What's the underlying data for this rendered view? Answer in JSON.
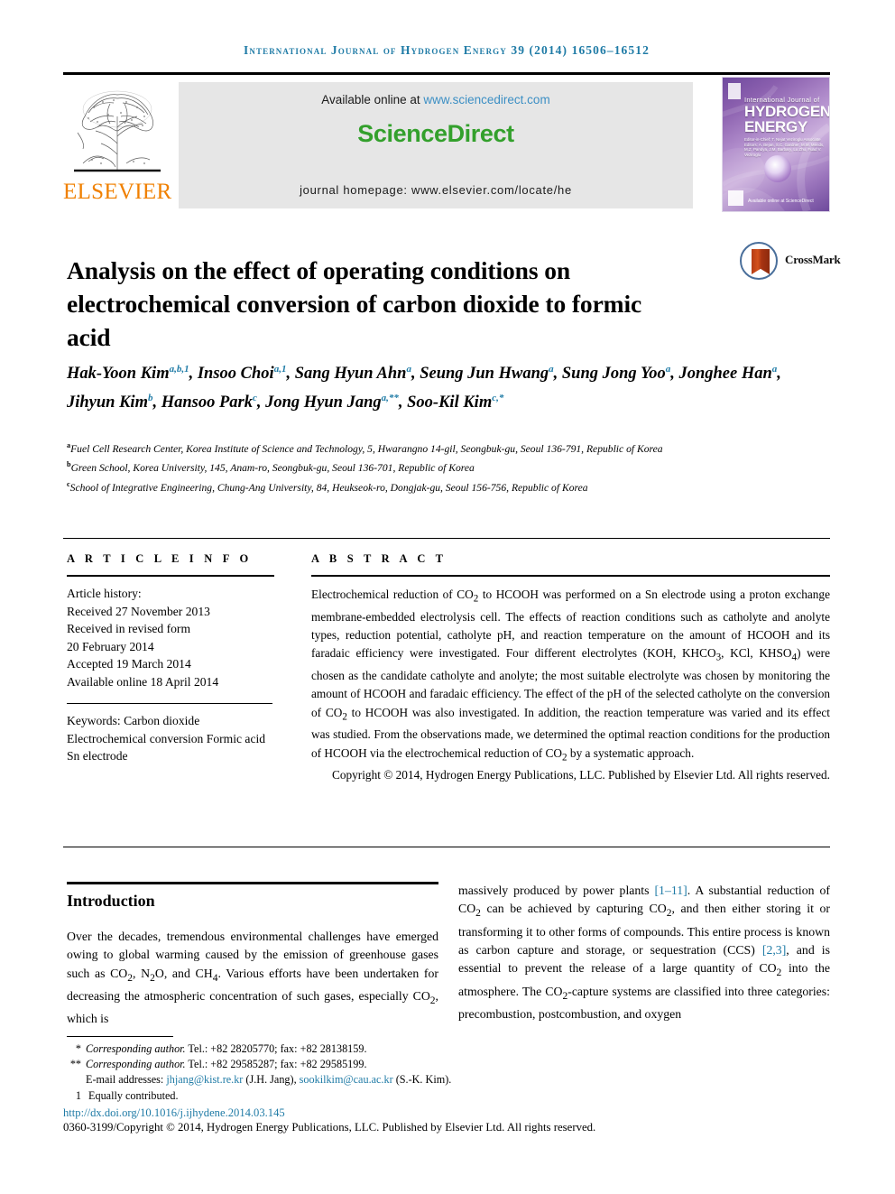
{
  "running_head": "International Journal of Hydrogen Energy 39 (2014) 16506–16512",
  "masthead": {
    "publisher_name": "ELSEVIER",
    "available_prefix": "Available online at ",
    "available_url": "www.sciencedirect.com",
    "brand": "ScienceDirect",
    "journal_homepage": "journal homepage: www.elsevier.com/locate/he",
    "cover": {
      "line1": "International Journal of",
      "line2": "HYDROGEN",
      "line3": "ENERGY",
      "editors": "Editor-in-Chief: T. Nejat Veziroglu   Associate Editors: A. Bejan, S.C. Gardner, M.M. Mends, M.Z. Pandya, J.M. Barbary, Lu Zhu, Fuad V. Veziroglu",
      "sciencedirect_badge": "Available online at ScienceDirect"
    }
  },
  "article": {
    "title": "Analysis on the effect of operating conditions on electrochemical conversion of carbon dioxide to formic acid",
    "crossmark_label": "CrossMark",
    "authors_html": "Hak-Yoon Kim<sup>a,b,1</sup>, Insoo Choi<sup>a,1</sup>, Sang Hyun Ahn<sup>a</sup>, Seung Jun Hwang<sup>a</sup>, Sung Jong Yoo<sup>a</sup>, Jonghee Han<sup>a</sup>, Jihyun Kim<sup>b</sup>, Hansoo Park<sup>c</sup>, Jong Hyun Jang<sup>a,**</sup>, Soo-Kil Kim<sup>c,*</sup>",
    "affiliations_html": "<sup>a</sup>Fuel Cell Research Center, Korea Institute of Science and Technology, 5, Hwarangno 14-gil, Seongbuk-gu, Seoul 136-791, Republic of Korea<br><sup>b</sup>Green School, Korea University, 145, Anam-ro, Seongbuk-gu, Seoul 136-701, Republic of Korea<br><sup>c</sup>School of Integrative Engineering, Chung-Ang University, 84, Heukseok-ro, Dongjak-gu, Seoul 156-756, Republic of Korea"
  },
  "article_info": {
    "heading": "A R T I C L E   I N F O",
    "history_label": "Article history:",
    "history": [
      "Received 27 November 2013",
      "Received in revised form",
      "20 February 2014",
      "Accepted 19 March 2014",
      "Available online 18 April 2014"
    ],
    "keywords_label": "Keywords:",
    "keywords": [
      "Carbon dioxide",
      "Electrochemical conversion",
      "Formic acid",
      "Sn electrode"
    ]
  },
  "abstract": {
    "heading": "A B S T R A C T",
    "text_html": "Electrochemical reduction of CO<sub>2</sub> to HCOOH was performed on a Sn electrode using a proton exchange membrane-embedded electrolysis cell. The effects of reaction conditions such as catholyte and anolyte types, reduction potential, catholyte pH, and reaction temperature on the amount of HCOOH and its faradaic efficiency were investigated. Four different electrolytes (KOH, KHCO<sub>3</sub>, KCl, KHSO<sub>4</sub>) were chosen as the candidate catholyte and anolyte; the most suitable electrolyte was chosen by monitoring the amount of HCOOH and faradaic efficiency. The effect of the pH of the selected catholyte on the conversion of CO<sub>2</sub> to HCOOH was also investigated. In addition, the reaction temperature was varied and its effect was studied. From the observations made, we determined the optimal reaction conditions for the production of HCOOH via the electrochemical reduction of CO<sub>2</sub> by a systematic approach.",
    "copyright": "Copyright © 2014, Hydrogen Energy Publications, LLC. Published by Elsevier Ltd. All rights reserved."
  },
  "introduction": {
    "heading": "Introduction",
    "left_html": "Over the decades, tremendous environmental challenges have emerged owing to global warming caused by the emission of greenhouse gases such as CO<sub>2</sub>, N<sub>2</sub>O, and CH<sub>4</sub>. Various efforts have been undertaken for decreasing the atmospheric concentration of such gases, especially CO<sub>2</sub>, which is",
    "right_html": "massively produced by power plants <span class=\"ref\">[1–11]</span>. A substantial reduction of CO<sub>2</sub> can be achieved by capturing CO<sub>2</sub>, and then either storing it or transforming it to other forms of compounds. This entire process is known as carbon capture and storage, or sequestration (CCS) <span class=\"ref\">[2,3]</span>, and is essential to prevent the release of a large quantity of CO<sub>2</sub> into the atmosphere. The CO<sub>2</sub>-capture systems are classified into three categories: precombustion, postcombustion, and oxygen"
  },
  "footnotes": {
    "corresponding_1_html": "<span class=\"fn-mark\">*</span><span class=\"fn-it\">Corresponding author.</span> Tel.: +82 28205770; fax: +82 28138159.",
    "corresponding_2_html": "<span class=\"fn-mark\">**</span><span class=\"fn-it\">Corresponding author.</span> Tel.: +82 29585287; fax: +82 29585199.",
    "emails_html": "<span class=\"fn-mark\"></span>E-mail addresses: <span class=\"link\">jhjang@kist.re.kr</span> (J.H. Jang), <span class=\"link\">sookilkim@cau.ac.kr</span> (S.-K. Kim).",
    "equal_html": "<span class=\"fn-mark\">1</span> Equally contributed.",
    "doi": "http://dx.doi.org/10.1016/j.ijhydene.2014.03.145",
    "issn_copyright": "0360-3199/Copyright © 2014, Hydrogen Energy Publications, LLC. Published by Elsevier Ltd. All rights reserved."
  },
  "colors": {
    "accent_blue": "#1f7ba6",
    "elsevier_orange": "#f08000",
    "sciencedirect_green": "#33a02c",
    "sd_box_gray": "#e6e6e6"
  }
}
